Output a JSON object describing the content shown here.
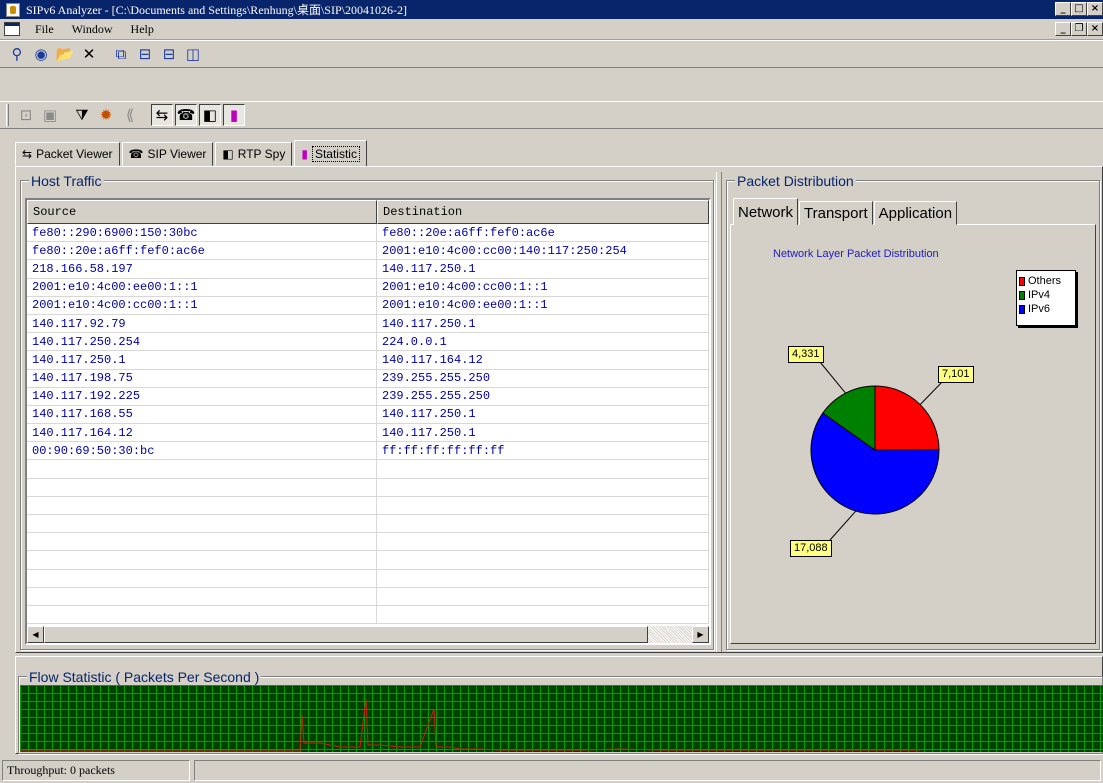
{
  "window": {
    "title": "SIPv6 Analyzer - [C:\\Documents and Settings\\Renhung\\桌面\\SIP\\20041026-2]"
  },
  "menu": {
    "items": [
      "File",
      "Window",
      "Help"
    ]
  },
  "tabs": [
    {
      "label": "Packet Viewer",
      "icon": "packet-viewer-icon"
    },
    {
      "label": "SIP Viewer",
      "icon": "phone-icon"
    },
    {
      "label": "RTP Spy",
      "icon": "rtp-icon"
    },
    {
      "label": "Statistic",
      "icon": "bar-chart-icon"
    }
  ],
  "host_traffic": {
    "title": "Host Traffic",
    "columns": [
      "Source",
      "Destination"
    ],
    "rows": [
      [
        "fe80::290:6900:150:30bc",
        "fe80::20e:a6ff:fef0:ac6e"
      ],
      [
        "fe80::20e:a6ff:fef0:ac6e",
        "2001:e10:4c00:cc00:140:117:250:254"
      ],
      [
        "218.166.58.197",
        "140.117.250.1"
      ],
      [
        "2001:e10:4c00:ee00:1::1",
        "2001:e10:4c00:cc00:1::1"
      ],
      [
        "2001:e10:4c00:cc00:1::1",
        "2001:e10:4c00:ee00:1::1"
      ],
      [
        "140.117.92.79",
        "140.117.250.1"
      ],
      [
        "140.117.250.254",
        "224.0.0.1"
      ],
      [
        "140.117.250.1",
        "140.117.164.12"
      ],
      [
        "140.117.198.75",
        "239.255.255.250"
      ],
      [
        "140.117.192.225",
        "239.255.255.250"
      ],
      [
        "140.117.168.55",
        "140.117.250.1"
      ],
      [
        "140.117.164.12",
        "140.117.250.1"
      ],
      [
        "00:90:69:50:30:bc",
        "ff:ff:ff:ff:ff:ff"
      ]
    ]
  },
  "packet_distribution": {
    "title": "Packet Distribution",
    "tabs": [
      "Network",
      "Transport",
      "Application"
    ],
    "active_tab": "Network"
  },
  "chart_data": {
    "type": "pie",
    "title": "Network Layer Packet Distribution",
    "legend_position": "top-right",
    "categories": [
      "Others",
      "IPv4",
      "IPv6"
    ],
    "values": [
      7101,
      4331,
      17088
    ],
    "labels": [
      "7,101",
      "4,331",
      "17,088"
    ],
    "colors": [
      "#ff0000",
      "#008000",
      "#0000ff"
    ]
  },
  "flow_statistic": {
    "title": "Flow Statistic ( Packets Per Second )"
  },
  "status": {
    "throughput": "Throughput: 0 packets"
  }
}
